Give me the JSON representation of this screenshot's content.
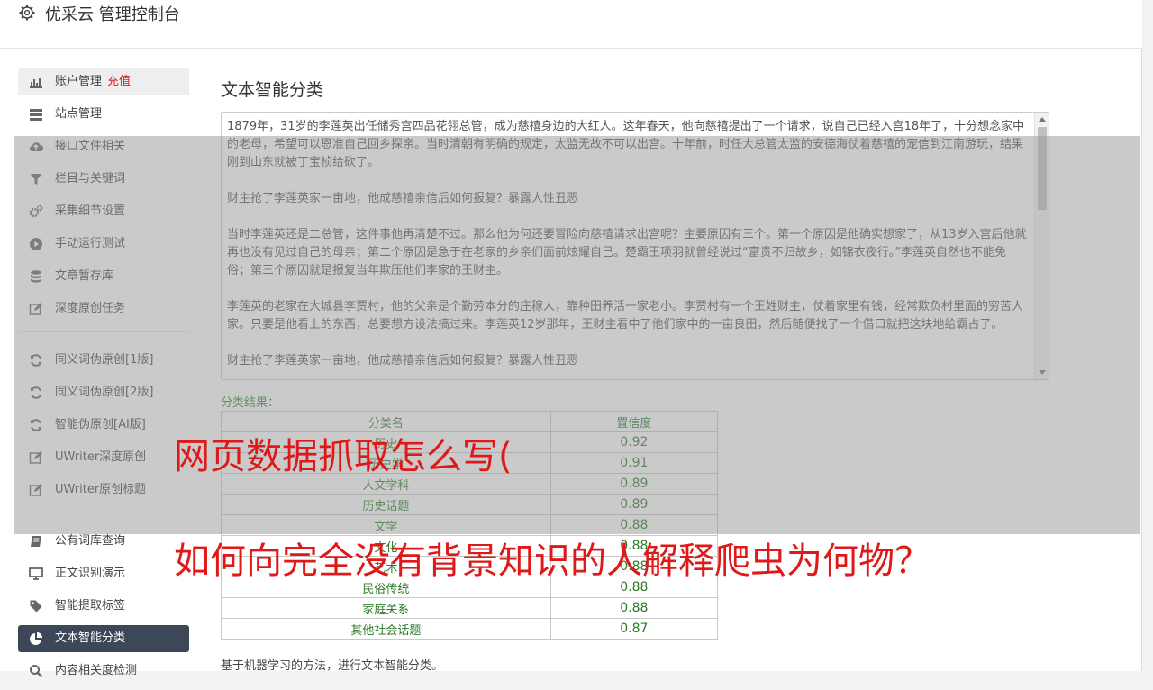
{
  "app": {
    "title": "优采云 管理控制台"
  },
  "sidebar": {
    "items": [
      {
        "label": "账户管理",
        "badge": "充值",
        "icon": "bar-chart-icon"
      },
      {
        "label": "站点管理",
        "icon": "server-icon"
      },
      {
        "label": "接口文件相关",
        "icon": "cloud-upload-icon"
      },
      {
        "label": "栏目与关键词",
        "icon": "filter-icon"
      },
      {
        "label": "采集细节设置",
        "icon": "gears-icon"
      },
      {
        "label": "手动运行测试",
        "icon": "play-circle-icon"
      },
      {
        "label": "文章暂存库",
        "icon": "database-icon"
      },
      {
        "label": "深度原创任务",
        "icon": "edit-icon"
      },
      {
        "label": "同义词伪原创[1版]",
        "icon": "refresh-icon"
      },
      {
        "label": "同义词伪原创[2版]",
        "icon": "refresh-icon"
      },
      {
        "label": "智能伪原创[AI版]",
        "icon": "refresh-icon"
      },
      {
        "label": "UWriter深度原创",
        "icon": "edit-icon"
      },
      {
        "label": "UWriter原创标题",
        "icon": "edit-icon"
      },
      {
        "label": "公有词库查询",
        "icon": "book-icon"
      },
      {
        "label": "正文识别演示",
        "icon": "monitor-icon"
      },
      {
        "label": "智能提取标签",
        "icon": "tag-icon"
      },
      {
        "label": "文本智能分类",
        "icon": "pie-chart-icon"
      },
      {
        "label": "内容相关度检测",
        "icon": "search-icon"
      }
    ]
  },
  "main": {
    "title": "文本智能分类",
    "text": "1879年，31岁的李莲英出任储秀宫四品花翎总管，成为慈禧身边的大红人。这年春天，他向慈禧提出了一个请求，说自己已经入宫18年了，十分想念家中的老母，希望可以恩准自己回乡探亲。当时清朝有明确的规定，太监无故不可以出宫。十年前，时任大总管太监的安德海仗着慈禧的宠信到江南游玩，结果刚到山东就被丁宝桢给砍了。\n\n财主抢了李莲英家一亩地，他成慈禧亲信后如何报复？暴露人性丑恶\n\n当时李莲英还是二总管，这件事他再清楚不过。那么他为何还要冒险向慈禧请求出宫呢？主要原因有三个。第一个原因是他确实想家了，从13岁入宫后他就再也没有见过自己的母亲；第二个原因是急于在老家的乡亲们面前炫耀自己。楚霸王项羽就曾经说过“富贵不归故乡，如锦衣夜行。”李莲英自然也不能免俗；第三个原因就是报复当年欺压他们李家的王财主。\n\n李莲英的老家在大城县李贾村，他的父亲是个勤劳本分的庄稼人，靠种田养活一家老小。李贾村有一个王姓财主，仗着家里有钱，经常欺负村里面的穷苦人家。只要是他看上的东西，总要想方设法搞过来。李莲英12岁那年，王财主看中了他们家中的一亩良田，然后随便找了一个借口就把这块地给霸占了。\n\n财主抢了李莲英家一亩地，他成慈禧亲信后如何报复？暴露人性丑恶",
    "result_label": "分类结果：",
    "table": {
      "headers": [
        "分类名",
        "置信度"
      ],
      "rows": [
        [
          "历史",
          "0.92"
        ],
        [
          "历史学",
          "0.91"
        ],
        [
          "人文学科",
          "0.89"
        ],
        [
          "历史话题",
          "0.89"
        ],
        [
          "文学",
          "0.88"
        ],
        [
          "文化",
          "0.88"
        ],
        [
          "艺术",
          "0.88"
        ],
        [
          "民俗传统",
          "0.88"
        ],
        [
          "家庭关系",
          "0.88"
        ],
        [
          "其他社会话题",
          "0.87"
        ]
      ]
    },
    "note": "基于机器学习的方法，进行文本智能分类。"
  },
  "overlay": {
    "line1": "网页数据抓取怎么写(",
    "line2": "如何向完全没有背景知识的人解释爬虫为何物？"
  },
  "colors": {
    "active_nav": "#3c4858",
    "recharge": "#e02020",
    "result_green": "#2a7a2a",
    "overlay_red": "#e01818"
  }
}
